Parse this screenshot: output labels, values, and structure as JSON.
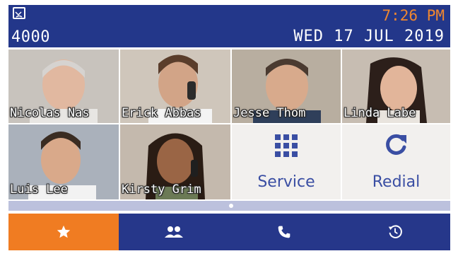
{
  "header": {
    "extension": "4000",
    "time": "7:26 PM",
    "date": "WED 17 JUL 2019"
  },
  "contacts": [
    {
      "name": "Nicolas Nas"
    },
    {
      "name": "Erick Abbas"
    },
    {
      "name": "Jesse Thom"
    },
    {
      "name": "Linda Labe"
    },
    {
      "name": "Luis Lee"
    },
    {
      "name": "Kirsty Grim"
    }
  ],
  "functions": {
    "service": "Service",
    "redial": "Redial"
  },
  "nav": {
    "active_index": 0,
    "items": [
      "star-icon",
      "contacts-icon",
      "phone-icon",
      "history-icon"
    ]
  },
  "colors": {
    "header_bg": "#23378a",
    "time": "#f0872f",
    "nav_bg": "#26378a",
    "nav_active": "#f07c22",
    "accent": "#3a4ea3"
  }
}
